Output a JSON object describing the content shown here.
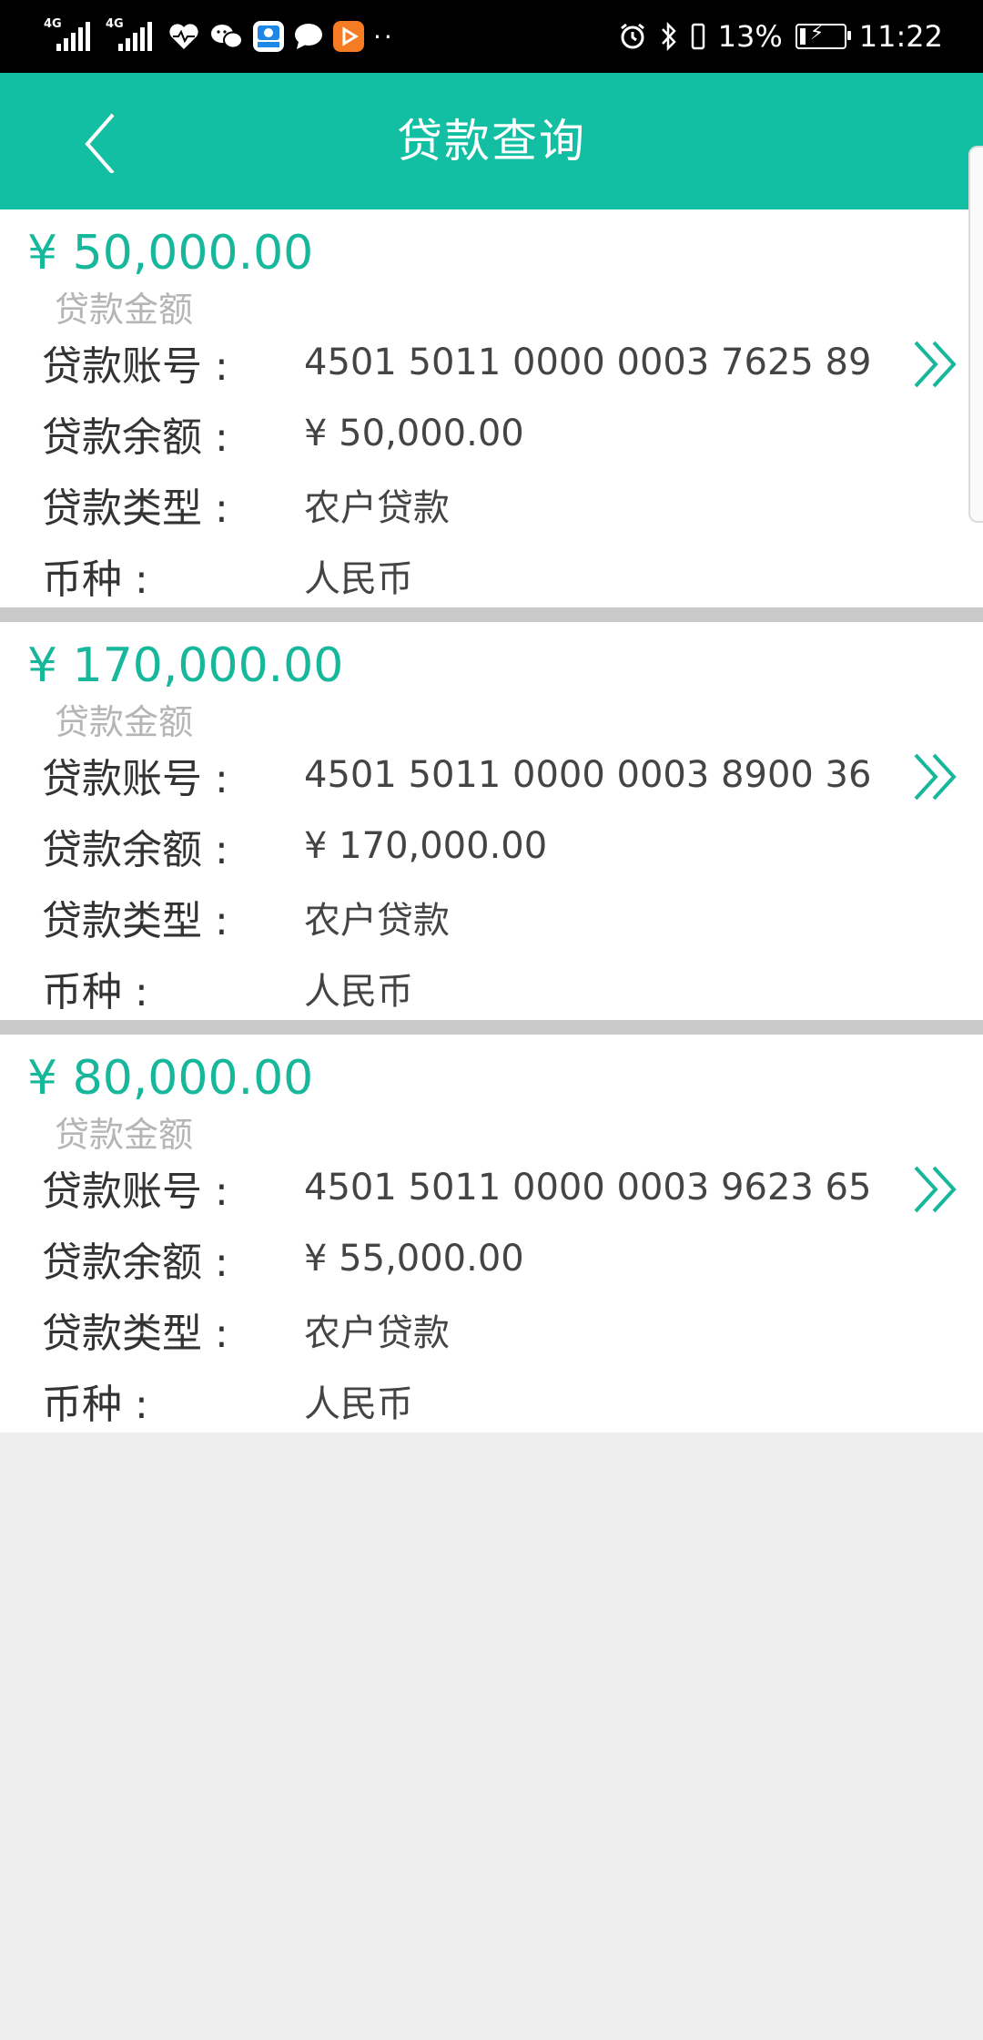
{
  "status_bar": {
    "network_1": "4G",
    "network_2": "4G",
    "battery": "13%",
    "time": "11:22"
  },
  "header": {
    "title": "贷款查询"
  },
  "colors": {
    "accent": "#12bfa2",
    "amount_text": "#16b79a",
    "muted_text": "#b5b5b5",
    "divider": "#c9c9c9"
  },
  "loans": [
    {
      "amount": "¥ 50,000.00",
      "amount_label": "贷款金额",
      "account_label": "贷款账号 :",
      "account": "4501 5011 0000 0003 7625 89",
      "balance_label": "贷款余额 :",
      "balance": "¥ 50,000.00",
      "type_label": "贷款类型 :",
      "type": "农户贷款",
      "currency_label": "币种 :",
      "currency": "人民币"
    },
    {
      "amount": "¥ 170,000.00",
      "amount_label": "贷款金额",
      "account_label": "贷款账号 :",
      "account": "4501 5011 0000 0003 8900 36",
      "balance_label": "贷款余额 :",
      "balance": "¥ 170,000.00",
      "type_label": "贷款类型 :",
      "type": "农户贷款",
      "currency_label": "币种 :",
      "currency": "人民币"
    },
    {
      "amount": "¥ 80,000.00",
      "amount_label": "贷款金额",
      "account_label": "贷款账号 :",
      "account": "4501 5011 0000 0003 9623 65",
      "balance_label": "贷款余额 :",
      "balance": "¥ 55,000.00",
      "type_label": "贷款类型 :",
      "type": "农户贷款",
      "currency_label": "币种 :",
      "currency": "人民币"
    }
  ]
}
